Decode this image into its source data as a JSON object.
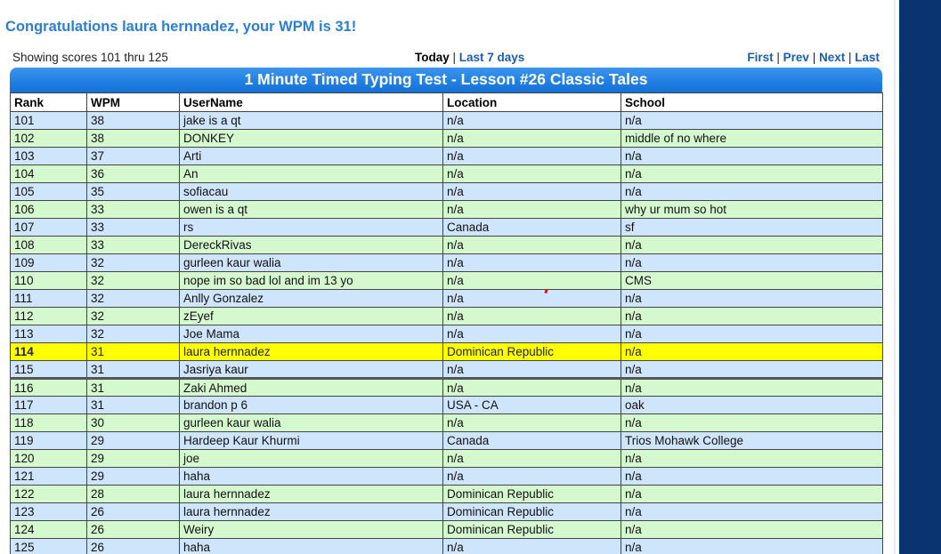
{
  "message": "Congratulations laura hernnadez, your WPM is 31!",
  "showing": "Showing scores 101 thru 125",
  "range": {
    "today": "Today",
    "sep": " | ",
    "last7": "Last 7 days"
  },
  "pager": {
    "first": "First",
    "prev": "Prev",
    "next": "Next",
    "last": "Last",
    "sep": " | "
  },
  "table": {
    "title": "1 Minute Timed Typing Test - Lesson #26 Classic Tales",
    "headers": [
      "Rank",
      "WPM",
      "UserName",
      "Location",
      "School"
    ],
    "rows": [
      [
        "101",
        "38",
        "jake is a qt",
        "n/a",
        "n/a"
      ],
      [
        "102",
        "38",
        "DONKEY",
        "n/a",
        "middle of no where"
      ],
      [
        "103",
        "37",
        "Arti",
        "n/a",
        "n/a"
      ],
      [
        "104",
        "36",
        "An",
        "n/a",
        "n/a"
      ],
      [
        "105",
        "35",
        "sofiacau",
        "n/a",
        "n/a"
      ],
      [
        "106",
        "33",
        "owen is a qt",
        "n/a",
        "why ur mum so hot"
      ],
      [
        "107",
        "33",
        "rs",
        "Canada",
        "sf"
      ],
      [
        "108",
        "33",
        "DereckRivas",
        "n/a",
        "n/a"
      ],
      [
        "109",
        "32",
        "gurleen kaur walia",
        "n/a",
        "n/a"
      ],
      [
        "110",
        "32",
        "nope im so bad lol and im 13 yo",
        "n/a",
        "CMS"
      ],
      [
        "111",
        "32",
        "Anlly Gonzalez",
        "n/a",
        "n/a"
      ],
      [
        "112",
        "32",
        "zEyef",
        "n/a",
        "n/a"
      ],
      [
        "113",
        "32",
        "Joe Mama",
        "n/a",
        "n/a"
      ],
      [
        "114",
        "31",
        "laura hernnadez",
        "Dominican Republic",
        "n/a"
      ],
      [
        "115",
        "31",
        "Jasriya kaur",
        "n/a",
        "n/a"
      ],
      [
        "116",
        "31",
        "Zaki Ahmed",
        "n/a",
        "n/a"
      ],
      [
        "117",
        "31",
        "brandon p 6",
        "USA - CA",
        "oak"
      ],
      [
        "118",
        "30",
        "gurleen kaur walia",
        "n/a",
        "n/a"
      ],
      [
        "119",
        "29",
        "Hardeep Kaur Khurmi",
        "Canada",
        "Trios Mohawk College"
      ],
      [
        "120",
        "29",
        "joe",
        "n/a",
        "n/a"
      ],
      [
        "121",
        "29",
        "haha",
        "n/a",
        "n/a"
      ],
      [
        "122",
        "28",
        "laura hernnadez",
        "Dominican Republic",
        "n/a"
      ],
      [
        "123",
        "26",
        "laura hernnadez",
        "Dominican Republic",
        "n/a"
      ],
      [
        "124",
        "26",
        "Weiry",
        "Dominican Republic",
        "n/a"
      ],
      [
        "125",
        "26",
        "haha",
        "n/a",
        "n/a"
      ]
    ],
    "highlight_rank": "114",
    "gap_after_rank": "115"
  },
  "colors": {
    "row_blue": "#cfe5fb",
    "row_green": "#d5f8cf",
    "highlight": "#ffff00",
    "header_bar": "#1a7ae0",
    "side_panel": "#0a3470"
  }
}
